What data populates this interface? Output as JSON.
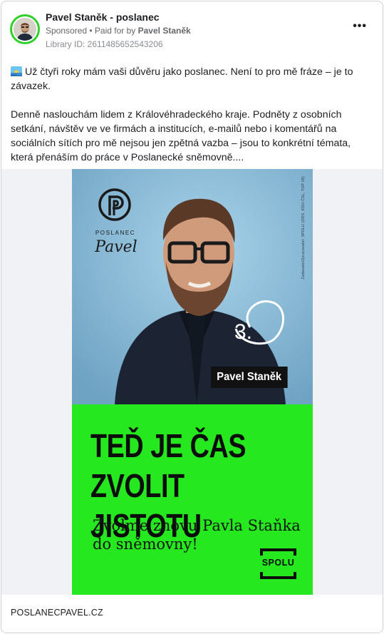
{
  "post": {
    "page_name": "Pavel Staněk - poslanec",
    "sponsored": "Sponsored",
    "paid_for_prefix": " • Paid for by ",
    "paid_for_by": "Pavel Staněk",
    "library_id": "Library ID: 2611485652543206",
    "more_label": "•••",
    "text_p1": "Už čtyři roky mám vaši důvěru jako poslanec. Není to pro mě fráze – je to závazek.",
    "text_p2": "Denně naslouchám lidem z Královéhradeckého kraje. Podněty z osobních setkání, návštěv ve ve firmách a institucích, e-mailů nebo i komentářů na sociálních sítích pro mě nejsou jen zpětná vazba – jsou to konkrétní témata, která přenáším do práce v Poslanecké sněmovně...."
  },
  "poster": {
    "logo_caption": "POSLANEC",
    "logo_name": "Pavel",
    "number": "3.",
    "candidate_name": "Pavel Staněk",
    "disclaimer": "Zadavatel/Zpracovatel: SPOLU (ODS, KDU-ČSL, TOP 09)",
    "headline_line1": "TEĎ JE ČAS",
    "headline_line2": "ZVOLIT JISTOTU",
    "subline_line1": "Zvolme znovu Pavla Staňka",
    "subline_line2": "do sněmovny!",
    "party_logo": "SPOLU"
  },
  "footer": {
    "link_domain": "POSLANECPAVEL.CZ"
  },
  "colors": {
    "poster_green": "#25e81f",
    "avatar_ring": "#2fd12a",
    "photo_sky": "#8fc0dc"
  }
}
